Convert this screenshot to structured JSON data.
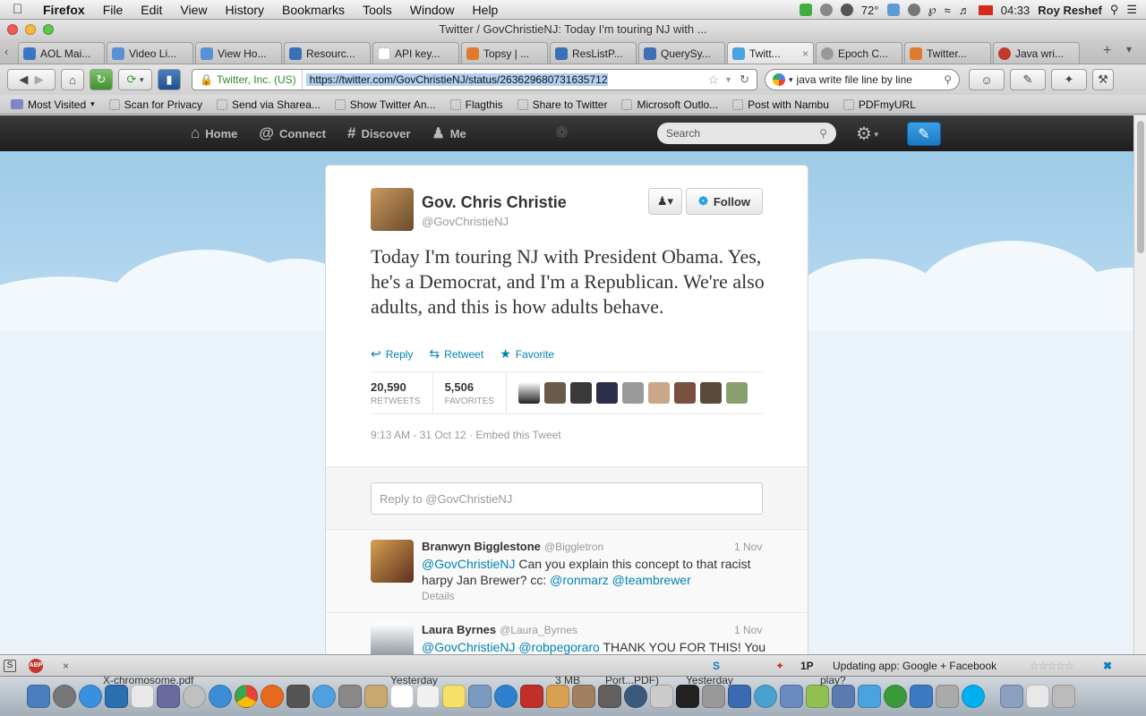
{
  "menubar": {
    "app": "Firefox",
    "items": [
      "File",
      "Edit",
      "View",
      "History",
      "Bookmarks",
      "Tools",
      "Window",
      "Help"
    ],
    "temperature": "72°",
    "time": "04:33",
    "user": "Roy Reshef"
  },
  "window": {
    "title": "Twitter / GovChristieNJ: Today I'm touring NJ with ..."
  },
  "tabs": [
    {
      "label": "AOL Mai...",
      "color": "#3a76c4"
    },
    {
      "label": "Video Li...",
      "color": "#5b8fd6"
    },
    {
      "label": "View Ho...",
      "color": "#5b8fd6"
    },
    {
      "label": "Resourc...",
      "color": "#3b6fb6"
    },
    {
      "label": "API key...",
      "color": "#cccccc"
    },
    {
      "label": "Topsy | ...",
      "color": "#e07a2e"
    },
    {
      "label": "ResListP...",
      "color": "#3b6fb6"
    },
    {
      "label": "QuerySy...",
      "color": "#3b6fb6"
    },
    {
      "label": "Twitt...",
      "color": "#4aa3df",
      "active": true
    },
    {
      "label": "Epoch C...",
      "color": "#999999"
    },
    {
      "label": "Twitter...",
      "color": "#e07a2e"
    },
    {
      "label": "Java wri...",
      "color": "#c0392b"
    }
  ],
  "navbar": {
    "identity": "Twitter, Inc. (US)",
    "url": "https://twitter.com/GovChristieNJ/status/263629680731635712",
    "search_query": "java write file line by line"
  },
  "bookmarks": [
    "Most Visited",
    "Scan for Privacy",
    "Send via Sharea...",
    "Show Twitter An...",
    "Flagthis",
    "Share to Twitter",
    "Microsoft Outlo...",
    "Post with Nambu",
    "PDFmyURL"
  ],
  "twitter_nav": {
    "home": "Home",
    "connect": "Connect",
    "discover": "Discover",
    "me": "Me",
    "search_placeholder": "Search"
  },
  "tweet": {
    "name": "Gov. Chris Christie",
    "handle": "@GovChristieNJ",
    "follow_label": "Follow",
    "text": "Today I'm touring NJ with President Obama. Yes, he's a Democrat, and I'm a Republican. We're also adults, and this is how adults behave.",
    "actions": {
      "reply": "Reply",
      "retweet": "Retweet",
      "favorite": "Favorite"
    },
    "retweets": "20,590",
    "retweets_label": "RETWEETS",
    "favorites": "5,506",
    "favorites_label": "FAVORITES",
    "timestamp": "9:13 AM - 31 Oct 12",
    "embed": "Embed this Tweet",
    "reply_placeholder": "Reply to @GovChristieNJ",
    "accent": "#0084b4"
  },
  "replies": [
    {
      "name": "Branwyn Bigglestone",
      "handle": "@Biggletron",
      "date": "1 Nov",
      "mention": "@GovChristieNJ",
      "text": " Can you explain this concept to that racist harpy Jan Brewer? cc: ",
      "mention2": "@ronmarz",
      "mention3": "@teambrewer",
      "details": "Details"
    },
    {
      "name": "Laura Byrnes",
      "handle": "@Laura_Byrnes",
      "date": "1 Nov",
      "mention": "@GovChristieNJ",
      "mention2": "@robpegoraro",
      "text": " THANK YOU FOR THIS! You"
    }
  ],
  "statusbar": {
    "updating": "Updating app: Google + Facebook",
    "abp": "ABP",
    "ip": "1P"
  },
  "dock": {
    "file1": "X-chromosome.pdf",
    "date1": "Yesterday",
    "size": "3 MB",
    "file2": "Port...PDF)",
    "date2": "Yesterday",
    "play": "play?"
  }
}
